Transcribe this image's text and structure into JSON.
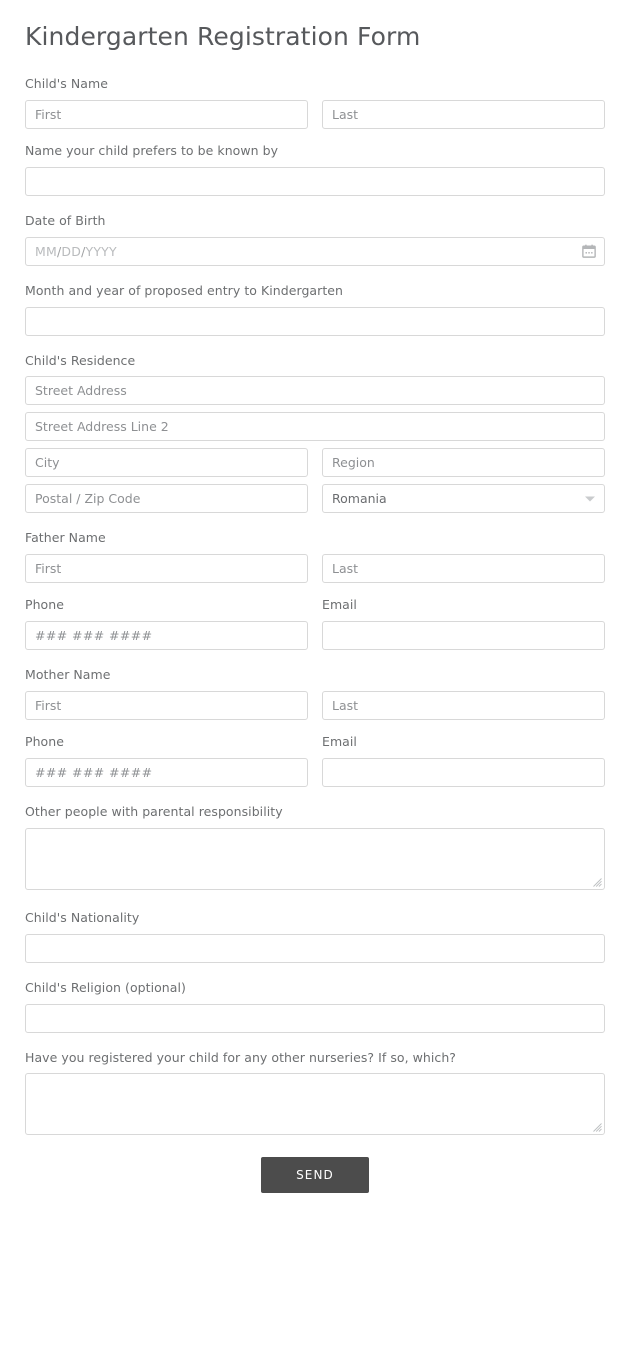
{
  "form": {
    "title": "Kindergarten Registration Form",
    "fields": {
      "child_name": {
        "label": "Child's Name",
        "first_placeholder": "First",
        "last_placeholder": "Last"
      },
      "preferred_name": {
        "label": "Name your child prefers to be known by",
        "value": ""
      },
      "date_of_birth": {
        "label": "Date of Birth",
        "placeholder_month": "MM",
        "placeholder_day": "DD",
        "placeholder_year": "YYYY",
        "separator": "/",
        "icon": "calendar-icon"
      },
      "entry_month_year": {
        "label": "Month and year of proposed entry to Kindergarten",
        "value": ""
      },
      "residence": {
        "label": "Child's Residence",
        "street_placeholder": "Street Address",
        "street2_placeholder": "Street Address Line 2",
        "city_placeholder": "City",
        "region_placeholder": "Region",
        "postal_placeholder": "Postal / Zip Code",
        "country_value": "Romania",
        "country_icon": "chevron-down-icon"
      },
      "father_name": {
        "label": "Father Name",
        "first_placeholder": "First",
        "last_placeholder": "Last"
      },
      "father_phone": {
        "label": "Phone",
        "placeholder": "### ### ####"
      },
      "father_email": {
        "label": "Email",
        "value": ""
      },
      "mother_name": {
        "label": "Mother Name",
        "first_placeholder": "First",
        "last_placeholder": "Last"
      },
      "mother_phone": {
        "label": "Phone",
        "placeholder": "### ### ####"
      },
      "mother_email": {
        "label": "Email",
        "value": ""
      },
      "other_parental": {
        "label": "Other people with parental responsibility",
        "value": ""
      },
      "nationality": {
        "label": "Child's Nationality",
        "value": ""
      },
      "religion": {
        "label": "Child's Religion (optional)",
        "value": ""
      },
      "other_nurseries": {
        "label": "Have you registered your child for any other nurseries? If so, which?",
        "value": ""
      }
    },
    "submit": {
      "label": "SEND"
    }
  },
  "colors": {
    "title": "#57595c",
    "label": "#6d6f71",
    "border": "#d8d8d8",
    "placeholder": "#8e9093",
    "button_bg": "#4c4c4c",
    "button_text": "#ffffff"
  }
}
